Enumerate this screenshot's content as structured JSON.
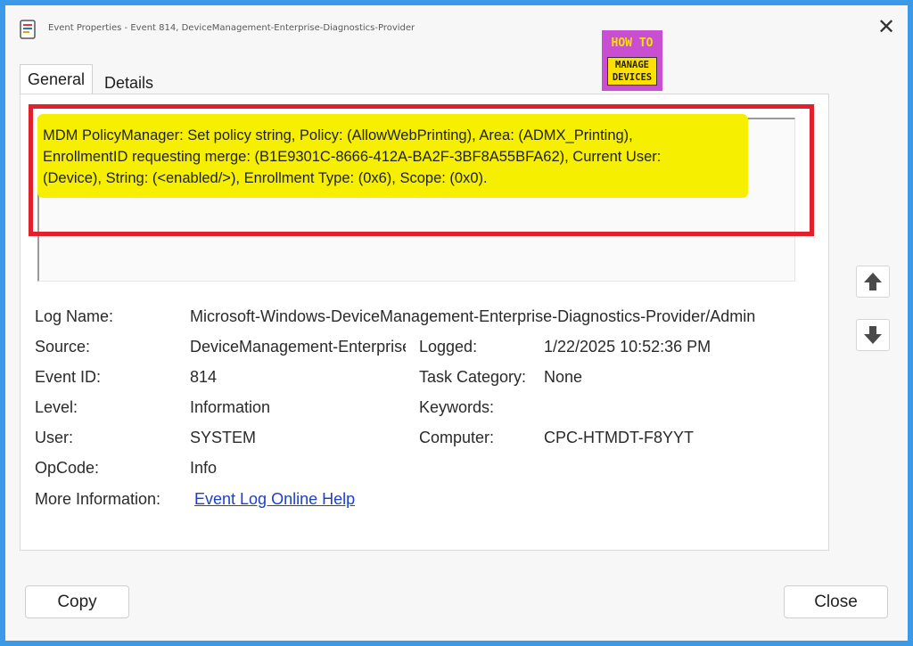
{
  "window": {
    "title": "Event Properties - Event 814, DeviceManagement-Enterprise-Diagnostics-Provider"
  },
  "logo": {
    "line1": "HOW TO",
    "line2": "MANAGE",
    "line3": "DEVICES"
  },
  "tabs": [
    {
      "label": "General"
    },
    {
      "label": "Details"
    }
  ],
  "description": {
    "line1": "MDM PolicyManager: Set policy string, Policy: (AllowWebPrinting), Area: (ADMX_Printing),",
    "line2": "EnrollmentID requesting merge: (B1E9301C-8666-412A-BA2F-3BF8A55BFA62), Current User:",
    "line3": "(Device), String: (<enabled/>), Enrollment Type: (0x6), Scope: (0x0)."
  },
  "fields": {
    "log_name_label": "Log Name:",
    "log_name": "Microsoft-Windows-DeviceManagement-Enterprise-Diagnostics-Provider/Admin",
    "source_label": "Source:",
    "source": "DeviceManagement-Enterprise-Diagnostics-Provider",
    "logged_label": "Logged:",
    "logged": "1/22/2025 10:52:36 PM",
    "event_id_label": "Event ID:",
    "event_id": "814",
    "task_category_label": "Task Category:",
    "task_category": "None",
    "level_label": "Level:",
    "level": "Information",
    "keywords_label": "Keywords:",
    "keywords": "",
    "user_label": "User:",
    "user": "SYSTEM",
    "computer_label": "Computer:",
    "computer": "CPC-HTMDT-F8YYT",
    "opcode_label": "OpCode:",
    "opcode": "Info",
    "more_info_label": "More Information:",
    "more_info_link": "Event Log Online Help"
  },
  "buttons": {
    "copy": "Copy",
    "close": "Close"
  },
  "icons": {
    "close": "close-icon",
    "up": "arrow-up-icon",
    "down": "arrow-down-icon",
    "app": "event-viewer-icon"
  },
  "colors": {
    "frame": "#3b9ae8",
    "highlight": "#f6f000",
    "red_box": "#e2202c",
    "link": "#1d3fcc",
    "logo_bg": "#c84fd1",
    "logo_accent": "#ffe100"
  }
}
